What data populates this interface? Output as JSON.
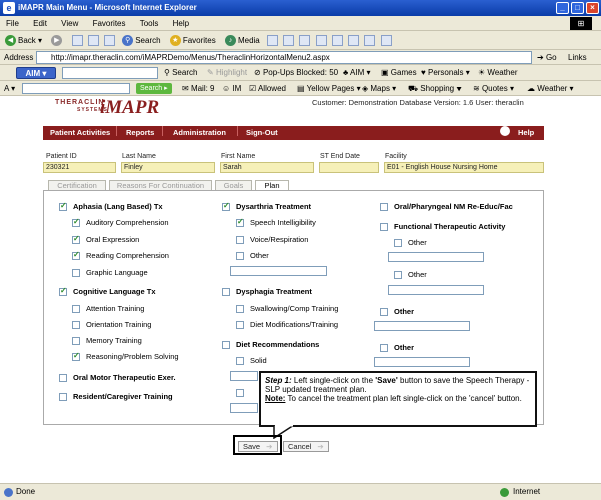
{
  "window": {
    "title": "iMAPR Main Menu - Microsoft Internet Explorer"
  },
  "menu": [
    "File",
    "Edit",
    "View",
    "Favorites",
    "Tools",
    "Help"
  ],
  "toolbar": {
    "back": "Back",
    "search": "Search",
    "favorites": "Favorites",
    "media": "Media"
  },
  "address": {
    "label": "Address",
    "url": "http://imapr.theraclin.com/iMAPRDemo/Menus/TheraclinHorizontalMenu2.aspx",
    "go": "Go",
    "links": "Links"
  },
  "aimbar": {
    "logo": "AIM",
    "search": "Search",
    "highlight": "Highlight",
    "popups": "Pop-Ups Blocked: 50",
    "aim": "AIM",
    "games": "Games",
    "personals": "Personals",
    "weather": "Weather"
  },
  "toolbar2": {
    "search": "Search",
    "mail": "Mail: 9",
    "im": "IM",
    "allowed": "Allowed",
    "yellow": "Yellow Pages",
    "maps": "Maps",
    "shopping": "Shopping",
    "quotes": "Quotes",
    "weather": "Weather"
  },
  "app": {
    "logo_sub": "THERACLIN",
    "logo_sub2": "SYSTEMS",
    "logo_main": "iMAPR",
    "customer": "Customer: Demonstration Database Version: 1.6 User: theraclin",
    "nav": [
      "Patient Activities",
      "Reports",
      "Administration",
      "Sign-Out"
    ],
    "help": "Help"
  },
  "patient": {
    "labels": {
      "id": "Patient ID",
      "last": "Last Name",
      "first": "First Name",
      "st_end": "ST End Date",
      "facility": "Facility"
    },
    "id": "230321",
    "last": "Finley",
    "first": "Sarah",
    "st_end": "",
    "facility": "E01 - English House Nursing Home"
  },
  "tabs": [
    "Certification",
    "Reasons For Continuation",
    "Goals",
    "Plan"
  ],
  "plan": {
    "col1": {
      "aphasia": "Aphasia (Lang Based) Tx",
      "aphasia_items": [
        "Auditory Comprehension",
        "Oral Expression",
        "Reading Comprehension",
        "Graphic Language"
      ],
      "cognitive": "Cognitive Language Tx",
      "cognitive_items": [
        "Attention Training",
        "Orientation Training",
        "Memory Training",
        "Reasoning/Problem Solving"
      ],
      "oral_motor": "Oral Motor Therapeutic Exer.",
      "resident": "Resident/Caregiver Training"
    },
    "col2": {
      "dysarthria": "Dysarthria Treatment",
      "dysarthria_items": [
        "Speech Intelligibility",
        "Voice/Respiration",
        "Other"
      ],
      "dysphagia": "Dysphagia Treatment",
      "dysphagia_items": [
        "Swallowing/Comp Training",
        "Diet Modifications/Training"
      ],
      "diet": "Diet Recommendations",
      "diet_items": [
        "Solid"
      ]
    },
    "col3": {
      "oral_pharyngeal": "Oral/Pharyngeal NM Re-Educ/Fac",
      "functional": "Functional Therapeutic Activity",
      "other": "Other"
    }
  },
  "callout": {
    "step": "Step 1:",
    "text": " Left single-click on the ",
    "save_quote": "'Save'",
    "text2": " button to save the Speech Therapy - SLP updated treatment plan.",
    "note": "Note:",
    "note_text": " To cancel the treatment plan left single-click on the 'cancel' button."
  },
  "buttons": {
    "save": "Save",
    "cancel": "Cancel"
  },
  "status": {
    "done": "Done",
    "zone": "Internet"
  }
}
